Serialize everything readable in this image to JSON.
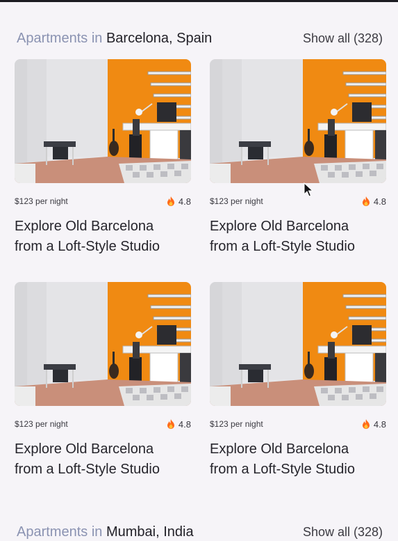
{
  "sections": [
    {
      "prefix": "Apartments in",
      "city": "Barcelona, Spain",
      "show_all": "Show all (328)",
      "listings": [
        {
          "price": "$123 per night",
          "rating": "4.8",
          "title_line1": "Explore Old Barcelona",
          "title_line2": "from a Loft-Style Studio"
        },
        {
          "price": "$123 per night",
          "rating": "4.8",
          "title_line1": "Explore Old Barcelona",
          "title_line2": "from a Loft-Style Studio"
        },
        {
          "price": "$123 per night",
          "rating": "4.8",
          "title_line1": "Explore Old Barcelona",
          "title_line2": "from a Loft-Style Studio"
        },
        {
          "price": "$123 per night",
          "rating": "4.8",
          "title_line1": "Explore Old Barcelona",
          "title_line2": "from a Loft-Style Studio"
        }
      ]
    },
    {
      "prefix": "Apartments in",
      "city": "Mumbai, India",
      "show_all": "Show all (328)"
    }
  ],
  "icons": {
    "rating": "flame-icon",
    "pointer": "mouse-cursor-icon"
  },
  "colors": {
    "background": "#f6f4f8",
    "title_prefix": "#8b93b2",
    "accent_wall": "#f08a12",
    "flame": "#ff6a1a"
  }
}
